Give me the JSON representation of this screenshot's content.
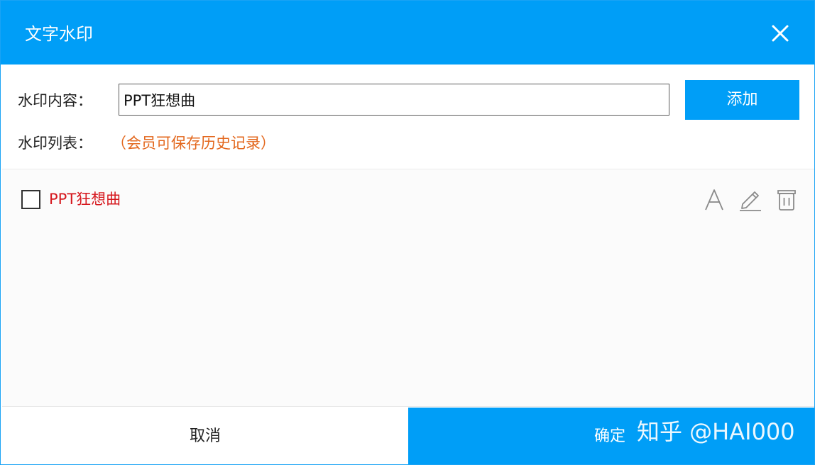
{
  "dialog": {
    "title": "文字水印",
    "close_icon": "close-icon"
  },
  "form": {
    "content_label": "水印内容：",
    "content_value": "PPT狂想曲",
    "add_label": "添加",
    "list_label": "水印列表：",
    "member_note": "（会员可保存历史记录）"
  },
  "watermark_list": {
    "items": [
      {
        "text": "PPT狂想曲",
        "checked": false,
        "actions": [
          "font-icon",
          "edit-icon",
          "delete-icon"
        ]
      }
    ]
  },
  "footer": {
    "cancel_label": "取消",
    "confirm_label": "确定"
  },
  "overlay": {
    "watermark_text": "知乎 @HAI000"
  },
  "colors": {
    "accent": "#009ef7",
    "member_note": "#e3671d",
    "item_text": "#d6181e"
  }
}
